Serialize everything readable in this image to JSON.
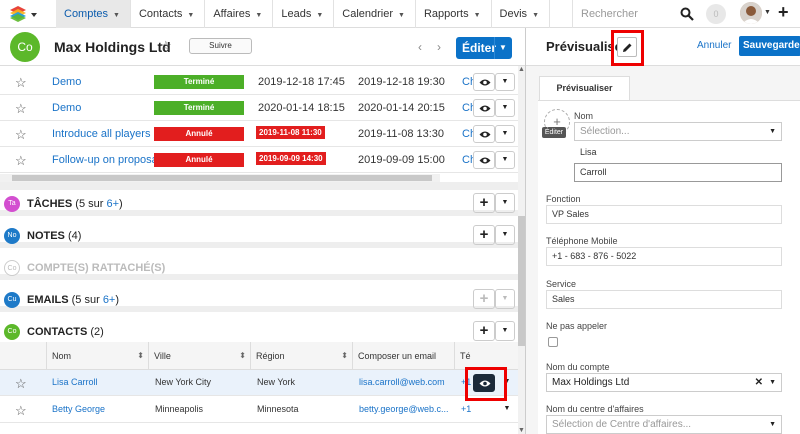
{
  "nav": {
    "tabs": [
      {
        "label": "Comptes",
        "active": true
      },
      {
        "label": "Contacts"
      },
      {
        "label": "Affaires"
      },
      {
        "label": "Leads"
      },
      {
        "label": "Calendrier"
      },
      {
        "label": "Rapports"
      },
      {
        "label": "Devis"
      }
    ],
    "search_placeholder": "Rechercher",
    "caret": "▼",
    "plus": "+"
  },
  "record": {
    "avatar": "Co",
    "name": "Max Holdings Ltd",
    "follow_label": "Suivre",
    "edit_label": "Éditer",
    "prev": "‹",
    "next": "›"
  },
  "meetings": [
    {
      "subject": "Demo",
      "status": "Terminé",
      "status_type": "done",
      "start": "2019-12-18 17:45",
      "start_bad": false,
      "end": "2019-12-18 19:30",
      "ch": "Ch"
    },
    {
      "subject": "Demo",
      "status": "Terminé",
      "status_type": "done",
      "start": "2020-01-14 18:15",
      "start_bad": false,
      "end": "2020-01-14 20:15",
      "ch": "Ch"
    },
    {
      "subject": "Introduce all players",
      "status": "Annulé",
      "status_type": "cancel",
      "start": "2019-11-08 11:30",
      "start_bad": true,
      "end": "2019-11-08 13:30",
      "ch": "Ch"
    },
    {
      "subject": "Follow-up on proposal",
      "status": "Annulé",
      "status_type": "cancel",
      "start": "2019-09-09 14:30",
      "start_bad": true,
      "end": "2019-09-09 15:00",
      "ch": "Ch"
    }
  ],
  "subpanels": {
    "tasks": {
      "badge": "Ta",
      "color": "#d34fd0",
      "title": "TÂCHES",
      "count_pre": "(5 sur ",
      "count_link": "6+",
      "count_post": ")"
    },
    "notes": {
      "badge": "No",
      "color": "#1e7ac8",
      "title": "NOTES",
      "count": "(4)"
    },
    "linked": {
      "badge": "Co",
      "color": "#cccccc",
      "title": "COMPTE(S) RATTACHÉ(S)"
    },
    "emails": {
      "badge": "Cu",
      "color": "#1e7ac8",
      "title": "EMAILS",
      "count_pre": "(5 sur ",
      "count_link": "6+",
      "count_post": ")"
    },
    "contacts": {
      "badge": "Co",
      "color": "#5cb82a",
      "title": "CONTACTS",
      "count": "(2)"
    }
  },
  "contacts_table": {
    "headers": [
      "Nom",
      "Ville",
      "Région",
      "Composer un email",
      "Té"
    ],
    "sort_icon": "⬍",
    "rows": [
      {
        "name": "Lisa Carroll",
        "city": "New York City",
        "region": "New York",
        "email": "lisa.carroll@web.com",
        "phone": "+1"
      },
      {
        "name": "Betty George",
        "city": "Minneapolis",
        "region": "Minnesota",
        "email": "betty.george@web.c...",
        "phone": "+1"
      }
    ]
  },
  "preview": {
    "title": "Prévisualiser",
    "cancel": "Annuler",
    "save": "Sauvegarder",
    "tab": "Prévisualiser",
    "photo_edit": "Éditer",
    "fields": {
      "name_label": "Nom",
      "salutation_placeholder": "Sélection...",
      "first_name": "Lisa",
      "last_name": "Carroll",
      "title_label": "Fonction",
      "title_value": "VP Sales",
      "mobile_label": "Téléphone Mobile",
      "mobile_value": "+1 - 683 - 876 - 5022",
      "dept_label": "Service",
      "dept_value": "Sales",
      "dnc_label": "Ne pas appeler",
      "account_label": "Nom du compte",
      "account_value": "Max Holdings Ltd",
      "bu_label": "Nom du centre d'affaires",
      "bu_placeholder": "Sélection de Centre d'affaires..."
    }
  }
}
